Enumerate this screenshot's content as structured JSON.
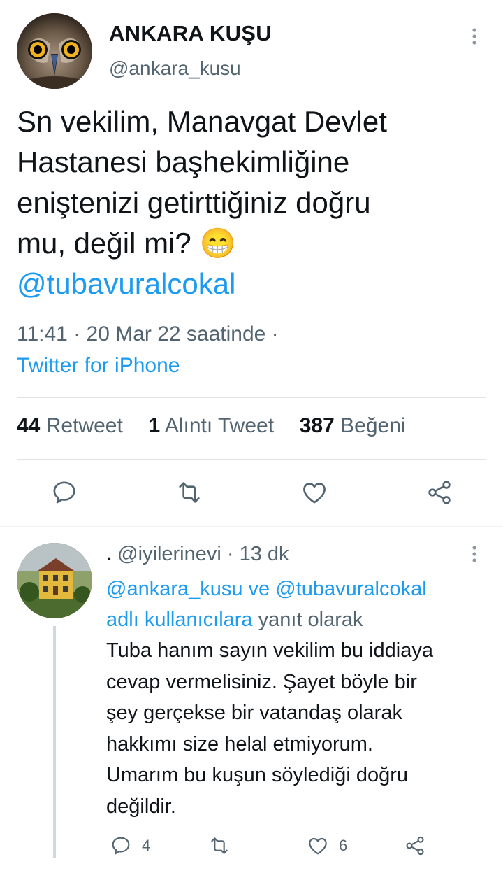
{
  "tweet": {
    "display_name": "ANKARA KUŞU",
    "handle": "@ankara_kusu",
    "text_lines": [
      "Sn vekilim, Manavgat Devlet",
      "Hastanesi başhekimliğine",
      "eniştenizi getirttiğiniz doğru",
      "mu, değil mi? "
    ],
    "emoji": "😁",
    "mention": "@tubavuralcokal",
    "timestamp": "11:41 · 20 Mar 22 saatinde ·",
    "source": "Twitter for iPhone",
    "stats": {
      "retweets_count": "44",
      "retweets_label": "Retweet",
      "quotes_count": "1",
      "quotes_label": "Alıntı Tweet",
      "likes_count": "387",
      "likes_label": "Beğeni"
    }
  },
  "reply": {
    "display_name": ".",
    "handle": "@iyilerinevi",
    "time": "· 13 dk",
    "replying_mentions": "@ankara_kusu ve @tubavuralcokal",
    "replying_users_label": "adlı kullanıcılara",
    "replying_suffix": "yanıt olarak",
    "body_lines": [
      "Tuba hanım sayın vekilim bu iddiaya",
      "cevap vermelisiniz. Şayet böyle bir",
      "şey gerçekse bir vatandaş olarak",
      "hakkımı size helal etmiyorum.",
      "Umarım bu kuşun söylediği doğru",
      "değildir."
    ],
    "reply_count": "4",
    "like_count": "6"
  },
  "icons": {
    "reply": "comment-icon",
    "retweet": "retweet-icon",
    "like": "heart-icon",
    "share": "share-icon",
    "more": "more-vertical-icon"
  },
  "colors": {
    "accent": "#1d9bf0",
    "secondary_text": "#536471",
    "primary_text": "#0f1419"
  }
}
